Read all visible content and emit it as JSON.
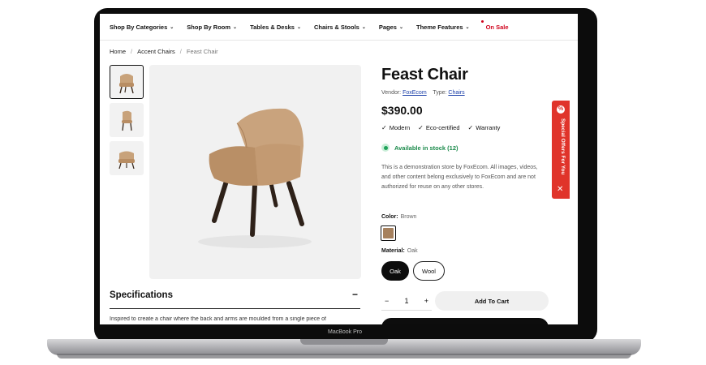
{
  "nav": {
    "items": [
      {
        "label": "Shop By Categories"
      },
      {
        "label": "Shop By Room"
      },
      {
        "label": "Tables & Desks"
      },
      {
        "label": "Chairs & Stools"
      },
      {
        "label": "Pages"
      },
      {
        "label": "Theme Features"
      }
    ],
    "sale_label": "On Sale",
    "chevron": "⌄"
  },
  "breadcrumb": {
    "home": "Home",
    "category": "Accent Chairs",
    "current": "Feast Chair"
  },
  "specifications": {
    "title": "Specifications",
    "toggle": "−",
    "text": "Inspired to create a chair where the back and arms are moulded from a single piece of"
  },
  "product": {
    "title": "Feast Chair",
    "vendor_label": "Vendor:",
    "vendor": "FoxEcom",
    "type_label": "Type:",
    "type": "Chairs",
    "price": "$390.00",
    "features": [
      "Modern",
      "Eco-certified",
      "Warranty"
    ],
    "stock": "Available in stock (12)",
    "description": "This is a demonstration store by FoxEcom. All images, videos, and other content belong exclusively to FoxEcom and are not authorized for reuse on any other stores.",
    "color_label": "Color:",
    "color_value": "Brown",
    "material_label": "Material:",
    "material_value": "Oak",
    "materials": [
      "Oak",
      "Wool"
    ],
    "quantity": "1",
    "minus": "−",
    "plus": "+",
    "add_to_cart": "Add To Cart"
  },
  "side_tab": {
    "label": "Special Offers For You",
    "gift": "%",
    "close": "✕"
  },
  "device": {
    "brand": "MacBook Pro"
  },
  "colors": {
    "sale": "#d0021b",
    "stock": "#1fa35a",
    "side_tab": "#e0342a",
    "swatch": "#a6815e"
  }
}
